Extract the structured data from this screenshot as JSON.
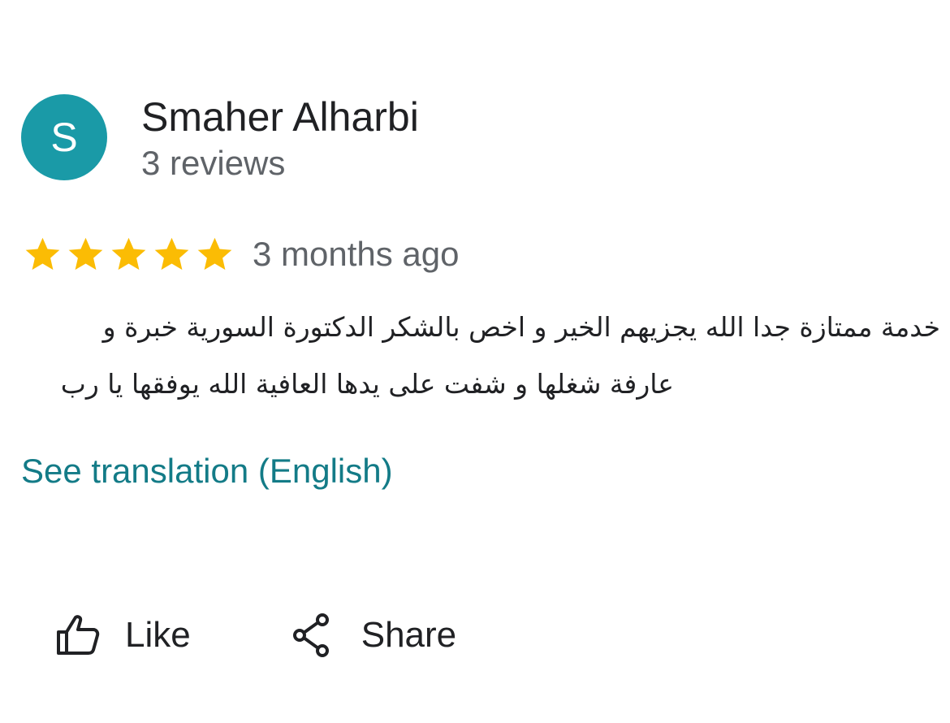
{
  "reviewer": {
    "avatar_initial": "S",
    "name": "Smaher Alharbi",
    "review_count": "3 reviews"
  },
  "rating": {
    "stars": 5,
    "max_stars": 5,
    "time_ago": "3 months ago"
  },
  "review": {
    "line1": "خدمة ممتازة جدا الله يجزيهم الخير و اخص بالشكر الدكتورة السورية خبرة و",
    "line2": "عارفة شغلها و شفت على يدها العافية الله يوفقها يا رب"
  },
  "translation_link": "See translation (English)",
  "actions": {
    "like_label": "Like",
    "share_label": "Share"
  },
  "colors": {
    "avatar_bg": "#1a9aa7",
    "star": "#fbbc04",
    "link": "#137b87"
  },
  "icons": [
    "thumbs-up-icon",
    "share-icon",
    "star-icon"
  ]
}
